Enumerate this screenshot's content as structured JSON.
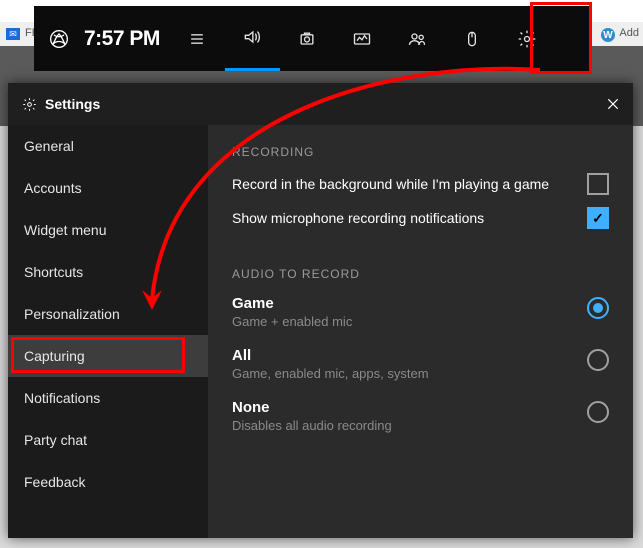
{
  "browser": {
    "tab_left_icon": "mail",
    "tab_left_text": "FE",
    "tab_right_icon": "W",
    "tab_right_text": "Add"
  },
  "gamebar": {
    "time": "7:57 PM",
    "icons": [
      "xbox",
      "list",
      "audio",
      "capture",
      "performance",
      "social",
      "mouse",
      "settings"
    ]
  },
  "settings": {
    "title": "Settings",
    "sidebar": [
      {
        "label": "General"
      },
      {
        "label": "Accounts"
      },
      {
        "label": "Widget menu"
      },
      {
        "label": "Shortcuts"
      },
      {
        "label": "Personalization"
      },
      {
        "label": "Capturing",
        "selected": true
      },
      {
        "label": "Notifications"
      },
      {
        "label": "Party chat"
      },
      {
        "label": "Feedback"
      }
    ],
    "recording": {
      "title": "RECORDING",
      "items": [
        {
          "label": "Record in the background while I'm playing a game",
          "checked": false
        },
        {
          "label": "Show microphone recording notifications",
          "checked": true
        }
      ]
    },
    "audio": {
      "title": "AUDIO TO RECORD",
      "options": [
        {
          "label": "Game",
          "desc": "Game + enabled mic",
          "selected": true
        },
        {
          "label": "All",
          "desc": "Game, enabled mic, apps, system",
          "selected": false
        },
        {
          "label": "None",
          "desc": "Disables all audio recording",
          "selected": false
        }
      ]
    }
  },
  "annotations": {
    "gear_highlighted": true,
    "capturing_highlighted": true,
    "arrow_from_gear_to_capturing": true
  }
}
